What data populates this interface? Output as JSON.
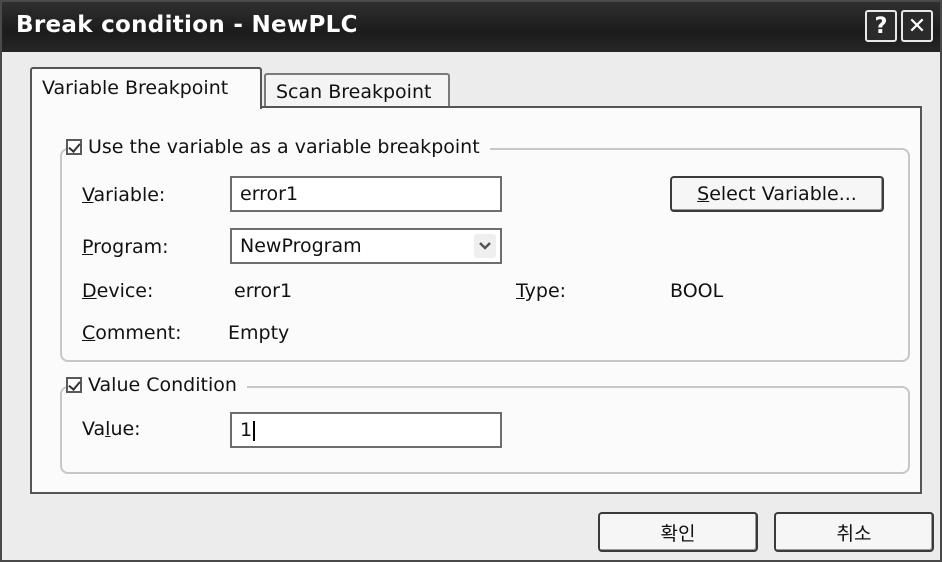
{
  "window": {
    "title": "Break condition - NewPLC",
    "help_glyph": "?",
    "close_glyph": "✕"
  },
  "tabs": [
    {
      "label": "Variable Breakpoint",
      "active": true
    },
    {
      "label": "Scan Breakpoint",
      "active": false
    }
  ],
  "variable_group": {
    "legend": "Use the variable as a variable breakpoint",
    "checked": true,
    "variable_label_pre": "V",
    "variable_label_post": "ariable:",
    "variable_value": "error1",
    "select_button": {
      "pre": "S",
      "post": "elect Variable..."
    },
    "program_label_pre": "P",
    "program_label_post": "rogram:",
    "program_value": "NewProgram",
    "device_label_pre": "D",
    "device_label_post": "evice:",
    "device_value": "error1",
    "type_label_pre": "T",
    "type_label_post": "ype:",
    "type_value": "BOOL",
    "comment_label_pre": "C",
    "comment_label_post": "omment:",
    "comment_value": "Empty"
  },
  "value_group": {
    "legend": "Value Condition",
    "checked": true,
    "value_label_pre": "Va",
    "value_label_u": "l",
    "value_label_post": "ue:",
    "value_text": "1"
  },
  "buttons": {
    "ok": "확인",
    "cancel": "취소"
  },
  "icons": {
    "combo_arrow": "chevron-down-icon",
    "check": "check-icon"
  }
}
